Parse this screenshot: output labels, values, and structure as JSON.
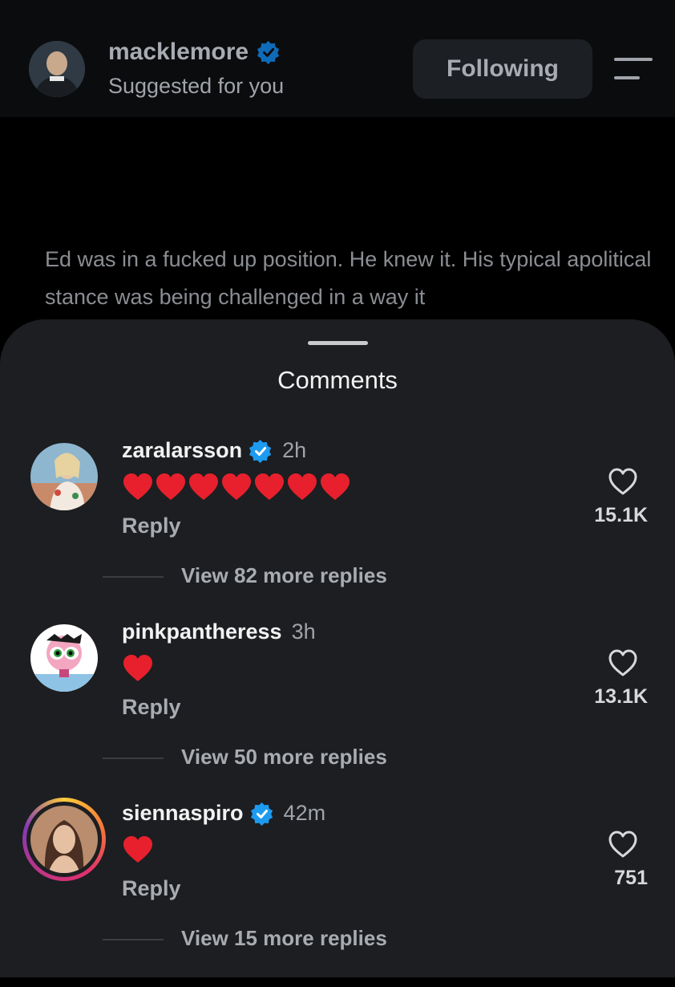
{
  "header": {
    "username": "macklemore",
    "subtitle": "Suggested for you",
    "follow_label": "Following",
    "verified": true
  },
  "post": {
    "text": "Ed was in a fucked up position. He knew it. His typical apolitical stance was being challenged in a way it"
  },
  "sheet": {
    "title": "Comments"
  },
  "comments": [
    {
      "username": "zaralarsson",
      "verified": true,
      "time": "2h",
      "hearts": 7,
      "reply_label": "Reply",
      "likes": "15.1K",
      "view_replies": "View 82 more replies"
    },
    {
      "username": "pinkpantheress",
      "verified": false,
      "time": "3h",
      "hearts": 1,
      "reply_label": "Reply",
      "likes": "13.1K",
      "view_replies": "View 50 more replies"
    },
    {
      "username": "siennaspiro",
      "verified": true,
      "time": "42m",
      "hearts": 1,
      "reply_label": "Reply",
      "likes": "751",
      "view_replies": "View 15 more replies"
    }
  ],
  "colors": {
    "verified_blue": "#1d9bf0",
    "heart_red": "#e8202d",
    "sheet_bg": "#1c1e21"
  }
}
